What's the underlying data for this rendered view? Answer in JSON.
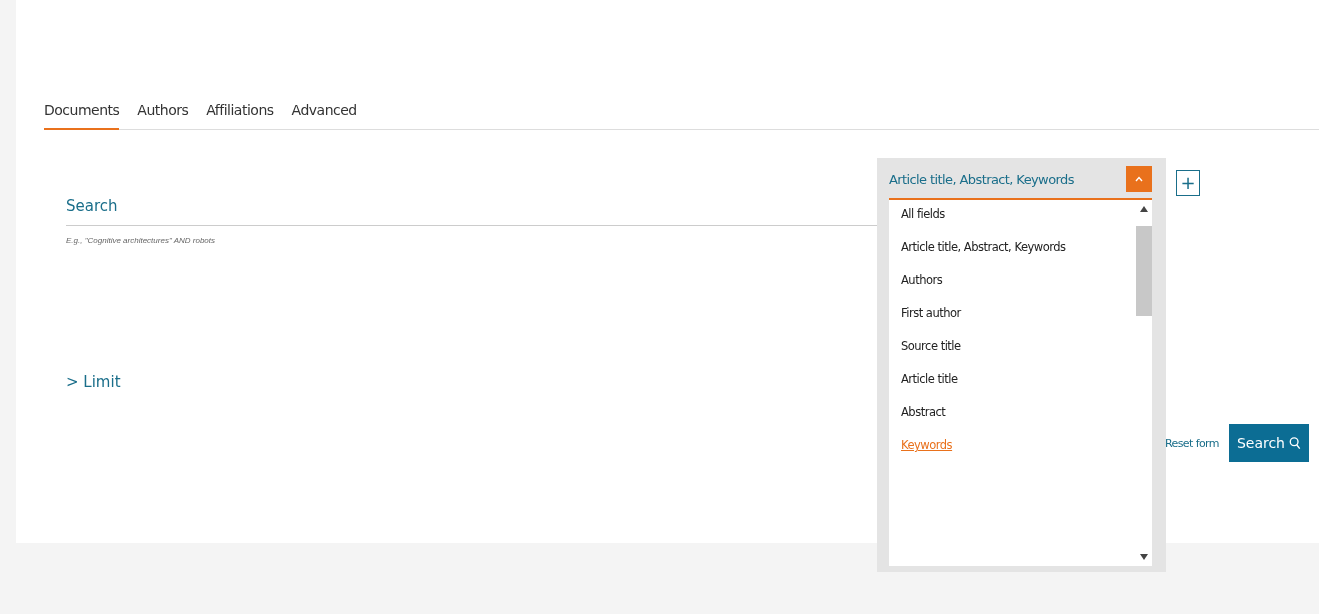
{
  "tabs": [
    {
      "label": "Documents",
      "selected": true
    },
    {
      "label": "Authors",
      "selected": false
    },
    {
      "label": "Affiliations",
      "selected": false
    },
    {
      "label": "Advanced",
      "selected": false
    }
  ],
  "search": {
    "label": "Search",
    "placeholder": "E.g., \"Cognitive architectures\" AND robots"
  },
  "field_select": {
    "value": "Article title, Abstract, Keywords",
    "expanded": true,
    "options": [
      {
        "label": "All fields",
        "focused": false
      },
      {
        "label": "Article title, Abstract, Keywords",
        "focused": false
      },
      {
        "label": "Authors",
        "focused": false
      },
      {
        "label": "First author",
        "focused": false
      },
      {
        "label": "Source title",
        "focused": false
      },
      {
        "label": "Article title",
        "focused": false
      },
      {
        "label": "Abstract",
        "focused": false
      },
      {
        "label": "Keywords",
        "focused": true
      }
    ]
  },
  "add_field_button": "+",
  "limit": "> Limit",
  "reset_link": "Reset form",
  "search_button": "Search"
}
